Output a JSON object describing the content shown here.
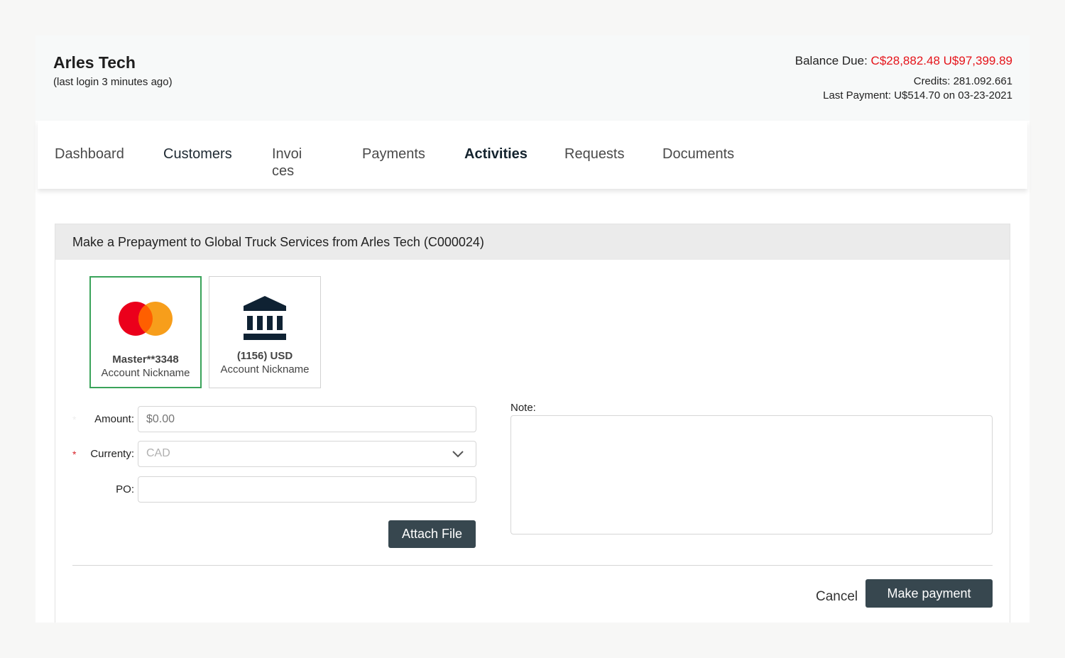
{
  "header": {
    "company_name": "Arles Tech",
    "last_login": "(last login 3 minutes ago)",
    "balance_label": "Balance Due: ",
    "balance_values": "C$28,882.48 U$97,399.89",
    "credits": "Credits: 281.092.661",
    "last_payment": "Last Payment: U$514.70 on 03-23-2021"
  },
  "nav": {
    "tabs": [
      {
        "label": "Dashboard"
      },
      {
        "label": "Customers"
      },
      {
        "label": "Invoi\nces"
      },
      {
        "label": "Payments"
      },
      {
        "label": "Activities"
      },
      {
        "label": "Requests"
      },
      {
        "label": "Documents"
      }
    ],
    "active": "Activities"
  },
  "form": {
    "title": "Make a Prepayment to Global Truck Services from Arles Tech (C000024)",
    "payment_methods": [
      {
        "line1": "Master**3348",
        "line2": "Account Nickname",
        "icon": "mastercard-icon",
        "selected": true
      },
      {
        "line1": "(1156) USD",
        "line2": "Account Nickname",
        "icon": "bank-icon",
        "selected": false
      }
    ],
    "amount_label": "Amount:",
    "amount_placeholder": "$0.00",
    "currency_label": "Currenty:",
    "currency_value": "CAD",
    "po_label": "PO:",
    "po_value": "",
    "required_mark": "*",
    "attach_label": "Attach File",
    "note_label": "Note:",
    "cancel_label": "Cancel",
    "submit_label": "Make payment"
  },
  "colors": {
    "accent_dark": "#37474f",
    "balance_red": "#e5141a",
    "selected_border": "#3aa35a",
    "mastercard_red": "#eb001b",
    "mastercard_orange": "#f79e1b",
    "bank_navy": "#0f2233"
  }
}
